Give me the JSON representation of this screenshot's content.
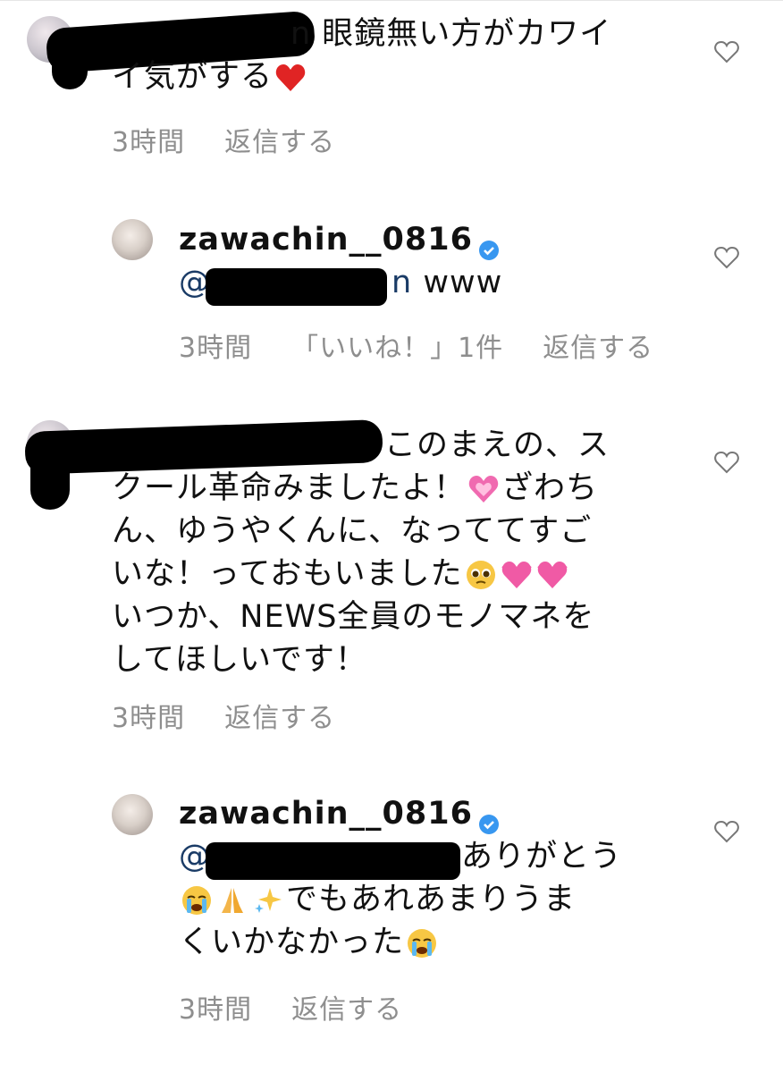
{
  "comments": [
    {
      "lines": [
        "n 眼鏡無い方がカワイ",
        "イ気がする"
      ],
      "time": "3時間",
      "reply": "返信する"
    },
    {
      "username": "zawachin__0816",
      "mention_tail": "n",
      "text": " www",
      "time": "3時間",
      "likes": "「いいね！」1件",
      "reply": "返信する"
    },
    {
      "lines": [
        "このまえの、ス",
        "クール革命みましたよ！",
        "ざわち",
        "ん、ゆうやくんに、なっててすご",
        "いな！っておもいました",
        "いつか、NEWS全員のモノマネを",
        "してほしいです！"
      ],
      "time": "3時間",
      "reply": "返信する"
    },
    {
      "username": "zawachin__0816",
      "mention_prefix": "@",
      "lines": [
        "ありがとう",
        "でもあれあまりうま",
        "くいかなかった"
      ],
      "time": "3時間",
      "reply": "返信する"
    }
  ],
  "mention_at": "@",
  "icons": [
    "heart-outline-icon",
    "verified-badge-icon",
    "red-heart-emoji",
    "pink-heart-emoji",
    "pleading-face-emoji",
    "two-hearts-emoji",
    "crying-face-emoji",
    "folded-hands-emoji",
    "sparkles-emoji"
  ],
  "colors": {
    "meta": "#8e8e8e",
    "mention": "#1a3b66",
    "verified": "#3897f0",
    "heart": "#e02424"
  }
}
